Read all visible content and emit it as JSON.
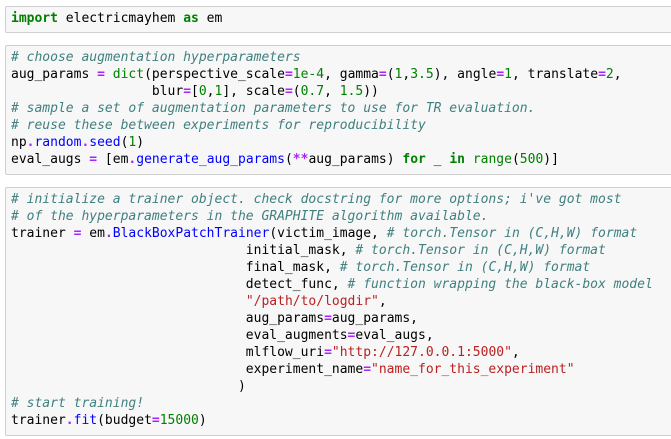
{
  "cells": [
    {
      "lines": [
        [
          [
            "kw",
            "import"
          ],
          [
            "t",
            " electricmayhem "
          ],
          [
            "kw",
            "as"
          ],
          [
            "t",
            " em"
          ]
        ]
      ]
    },
    {
      "lines": [
        [
          [
            "cm",
            "# choose augmentation hyperparameters"
          ]
        ],
        [
          [
            "t",
            "aug_params "
          ],
          [
            "op",
            "="
          ],
          [
            "t",
            " "
          ],
          [
            "bi",
            "dict"
          ],
          [
            "t",
            "(perspective_scale"
          ],
          [
            "op",
            "="
          ],
          [
            "num",
            "1e-4"
          ],
          [
            "t",
            ", gamma"
          ],
          [
            "op",
            "="
          ],
          [
            "t",
            "("
          ],
          [
            "num",
            "1"
          ],
          [
            "t",
            ","
          ],
          [
            "num",
            "3.5"
          ],
          [
            "t",
            "), angle"
          ],
          [
            "op",
            "="
          ],
          [
            "num",
            "1"
          ],
          [
            "t",
            ", translate"
          ],
          [
            "op",
            "="
          ],
          [
            "num",
            "2"
          ],
          [
            "t",
            ","
          ]
        ],
        [
          [
            "t",
            "                  blur"
          ],
          [
            "op",
            "="
          ],
          [
            "t",
            "["
          ],
          [
            "num",
            "0"
          ],
          [
            "t",
            ","
          ],
          [
            "num",
            "1"
          ],
          [
            "t",
            "], scale"
          ],
          [
            "op",
            "="
          ],
          [
            "t",
            "("
          ],
          [
            "num",
            "0.7"
          ],
          [
            "t",
            ", "
          ],
          [
            "num",
            "1.5"
          ],
          [
            "t",
            "))"
          ]
        ],
        [
          [
            "cm",
            "# sample a set of augmentation parameters to use for TR evaluation."
          ]
        ],
        [
          [
            "cm",
            "# reuse these between experiments for reproducibility"
          ]
        ],
        [
          [
            "t",
            "np"
          ],
          [
            "op",
            "."
          ],
          [
            "fn",
            "random"
          ],
          [
            "op",
            "."
          ],
          [
            "fn",
            "seed"
          ],
          [
            "t",
            "("
          ],
          [
            "num",
            "1"
          ],
          [
            "t",
            ")"
          ]
        ],
        [
          [
            "t",
            "eval_augs "
          ],
          [
            "op",
            "="
          ],
          [
            "t",
            " [em"
          ],
          [
            "op",
            "."
          ],
          [
            "fn",
            "generate_aug_params"
          ],
          [
            "t",
            "("
          ],
          [
            "op",
            "**"
          ],
          [
            "t",
            "aug_params) "
          ],
          [
            "kw",
            "for"
          ],
          [
            "t",
            " _ "
          ],
          [
            "kw",
            "in"
          ],
          [
            "t",
            " "
          ],
          [
            "bi",
            "range"
          ],
          [
            "t",
            "("
          ],
          [
            "num",
            "500"
          ],
          [
            "t",
            ")]"
          ]
        ]
      ]
    },
    {
      "lines": [
        [
          [
            "cm",
            "# initialize a trainer object. check docstring for more options; i've got most"
          ]
        ],
        [
          [
            "cm",
            "# of the hyperparameters in the GRAPHITE algorithm available."
          ]
        ],
        [
          [
            "t",
            "trainer "
          ],
          [
            "op",
            "="
          ],
          [
            "t",
            " em"
          ],
          [
            "op",
            "."
          ],
          [
            "fn",
            "BlackBoxPatchTrainer"
          ],
          [
            "t",
            "(victim_image, "
          ],
          [
            "cm",
            "# torch.Tensor in (C,H,W) format"
          ]
        ],
        [
          [
            "t",
            "                              initial_mask, "
          ],
          [
            "cm",
            "# torch.Tensor in (C,H,W) format"
          ]
        ],
        [
          [
            "t",
            "                              final_mask, "
          ],
          [
            "cm",
            "# torch.Tensor in (C,H,W) format"
          ]
        ],
        [
          [
            "t",
            "                              detect_func, "
          ],
          [
            "cm",
            "# function wrapping the black-box model"
          ]
        ],
        [
          [
            "t",
            "                              "
          ],
          [
            "st",
            "\"/path/to/logdir\""
          ],
          [
            "t",
            ","
          ]
        ],
        [
          [
            "t",
            "                              aug_params"
          ],
          [
            "op",
            "="
          ],
          [
            "t",
            "aug_params,"
          ]
        ],
        [
          [
            "t",
            "                              eval_augments"
          ],
          [
            "op",
            "="
          ],
          [
            "t",
            "eval_augs,"
          ]
        ],
        [
          [
            "t",
            "                              mlflow_uri"
          ],
          [
            "op",
            "="
          ],
          [
            "st",
            "\"http://127.0.0.1:5000\""
          ],
          [
            "t",
            ","
          ]
        ],
        [
          [
            "t",
            "                              experiment_name"
          ],
          [
            "op",
            "="
          ],
          [
            "st",
            "\"name_for_this_experiment\""
          ]
        ],
        [
          [
            "t",
            "                             )"
          ]
        ],
        [
          [
            "cm",
            "# start training!"
          ]
        ],
        [
          [
            "t",
            "trainer"
          ],
          [
            "op",
            "."
          ],
          [
            "fn",
            "fit"
          ],
          [
            "t",
            "(budget"
          ],
          [
            "op",
            "="
          ],
          [
            "num",
            "15000"
          ],
          [
            "t",
            ")"
          ]
        ]
      ]
    }
  ]
}
